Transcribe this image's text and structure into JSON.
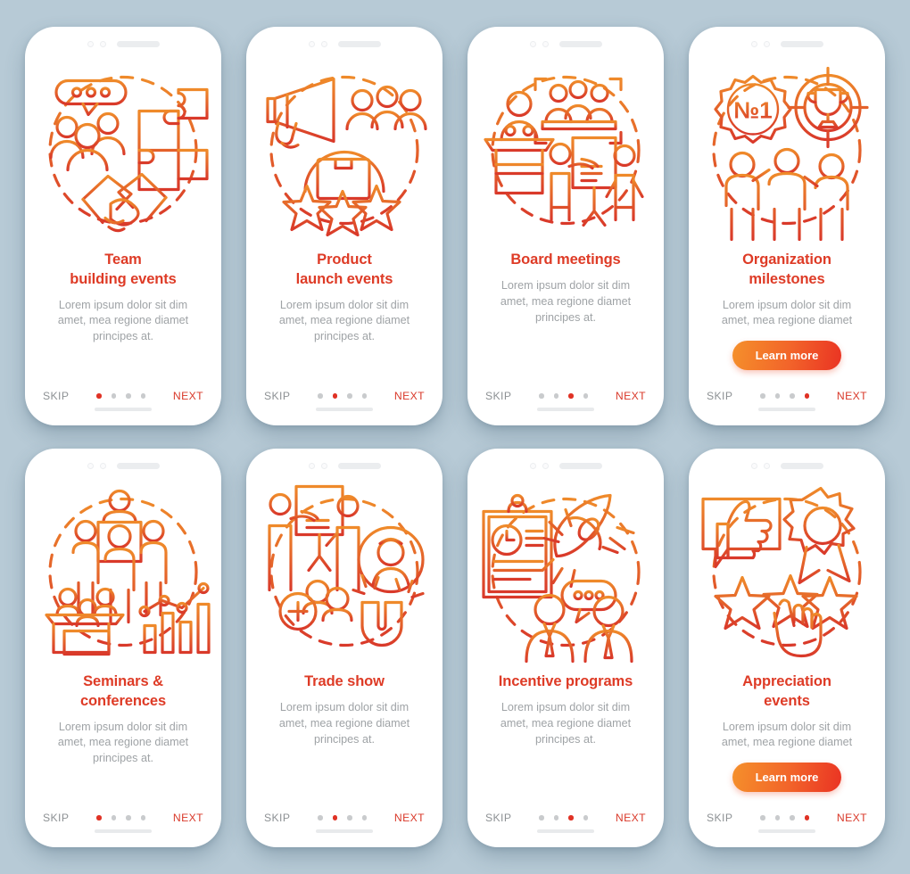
{
  "meta": {
    "background_color": "#b7cad6",
    "card_color": "#ffffff",
    "accent_title_color": "#de3b26",
    "accent_next_color": "#d9392a",
    "muted_text_color": "#9fa3a6",
    "skip_color": "#8d9194",
    "dot_inactive_color": "#c9cbcd",
    "dot_active_color": "#e03225",
    "gradient_start": "#f5902b",
    "gradient_end": "#ea3323"
  },
  "common": {
    "skip_label": "SKIP",
    "next_label": "NEXT",
    "description": "Lorem ipsum dolor sit dim\namet, mea regione diamet\nprincipes at.",
    "description_short": "Lorem ipsum dolor sit dim\namet, mea regione diamet",
    "cta_label": "Learn more",
    "dot_count": 4
  },
  "screens": [
    {
      "id": "team-building-events",
      "title": "Team\nbuilding events",
      "description": "Lorem ipsum dolor sit dim\namet, mea regione diamet\nprincipes at.",
      "illustration": "speech-bubble-people-puzzle-handshake-icon",
      "has_cta": false,
      "cta_label": "",
      "active_dot": 1,
      "skip_label": "SKIP",
      "next_label": "NEXT"
    },
    {
      "id": "product-launch-events",
      "title": "Product\nlaunch events",
      "description": "Lorem ipsum dolor sit dim\namet, mea regione diamet\nprincipes at.",
      "illustration": "megaphone-people-box-stars-icon",
      "has_cta": false,
      "cta_label": "",
      "active_dot": 2,
      "skip_label": "SKIP",
      "next_label": "NEXT"
    },
    {
      "id": "board-meetings",
      "title": "Board meetings",
      "description": "Lorem ipsum dolor sit dim\namet, mea regione diamet\nprincipes at.",
      "illustration": "podium-boardroom-presentation-icon",
      "has_cta": false,
      "cta_label": "",
      "active_dot": 3,
      "skip_label": "SKIP",
      "next_label": "NEXT"
    },
    {
      "id": "organization-milestones",
      "title": "Organization\nmilestones",
      "description": "Lorem ipsum dolor sit dim\namet, mea regione diamet",
      "illustration": "number-one-badge-trophy-target-team-icon",
      "has_cta": true,
      "cta_label": "Learn more",
      "active_dot": 4,
      "skip_label": "SKIP",
      "next_label": "NEXT"
    },
    {
      "id": "seminars-conferences",
      "title": "Seminars &\nconferences",
      "description": "Lorem ipsum dolor sit dim\namet, mea regione diamet\nprincipes at.",
      "illustration": "audience-stage-desk-chart-icon",
      "has_cta": false,
      "cta_label": "",
      "active_dot": 1,
      "skip_label": "SKIP",
      "next_label": "NEXT"
    },
    {
      "id": "trade-show",
      "title": "Trade show",
      "description": "Lorem ipsum dolor sit dim\namet, mea regione diamet\nprincipes at.",
      "illustration": "presentation-add-user-magnet-avatar-icon",
      "has_cta": false,
      "cta_label": "",
      "active_dot": 2,
      "skip_label": "SKIP",
      "next_label": "NEXT"
    },
    {
      "id": "incentive-programs",
      "title": "Incentive programs",
      "description": "Lorem ipsum dolor sit dim\namet, mea regione diamet\nprincipes at.",
      "illustration": "clipboard-rocket-employees-chat-icon",
      "has_cta": false,
      "cta_label": "",
      "active_dot": 3,
      "skip_label": "SKIP",
      "next_label": "NEXT"
    },
    {
      "id": "appreciation-events",
      "title": "Appreciation\nevents",
      "description": "Lorem ipsum dolor sit dim\namet, mea regione diamet",
      "illustration": "thumbs-up-award-ribbon-stars-hand-icon",
      "has_cta": true,
      "cta_label": "Learn more",
      "active_dot": 4,
      "skip_label": "SKIP",
      "next_label": "NEXT"
    }
  ]
}
